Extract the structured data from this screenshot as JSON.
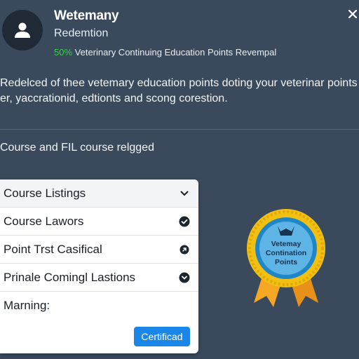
{
  "header": {
    "app_title": "Wetemany",
    "subtitle": "Redemtion",
    "progress_percent": "50%",
    "progress_text": "Veterinary Continuing Education Points Revempal",
    "close_label": "×"
  },
  "description": {
    "line1": "Redelced of thee vetemary education points doting your veterinar points",
    "line2": "er, yaccrationid, edtionts and scong corestion."
  },
  "section": {
    "heading": "Course and FIL course relgged"
  },
  "panel": {
    "rows": [
      {
        "label": "Course Listings",
        "icon": "chevron-down-icon"
      },
      {
        "label": "Course Lawors",
        "icon": "check-circle-icon"
      },
      {
        "label": "Point Trst Casifical",
        "icon": "arrow-circle-icon"
      },
      {
        "label": "Prinale Comingl Lastions",
        "icon": "check-circle-icon"
      }
    ],
    "warning_label": "Marning:",
    "certificate_button": "Certificad"
  },
  "badge": {
    "line1": "Vetemay",
    "line2": "Contination",
    "line3": "Points",
    "colors": {
      "ring": "#f2c012",
      "inner": "#1f87c8",
      "ribbon": "#f5a623"
    }
  },
  "colors": {
    "background": "#3a4a5c",
    "accent": "#1a87e8",
    "progress": "#35d04a"
  }
}
